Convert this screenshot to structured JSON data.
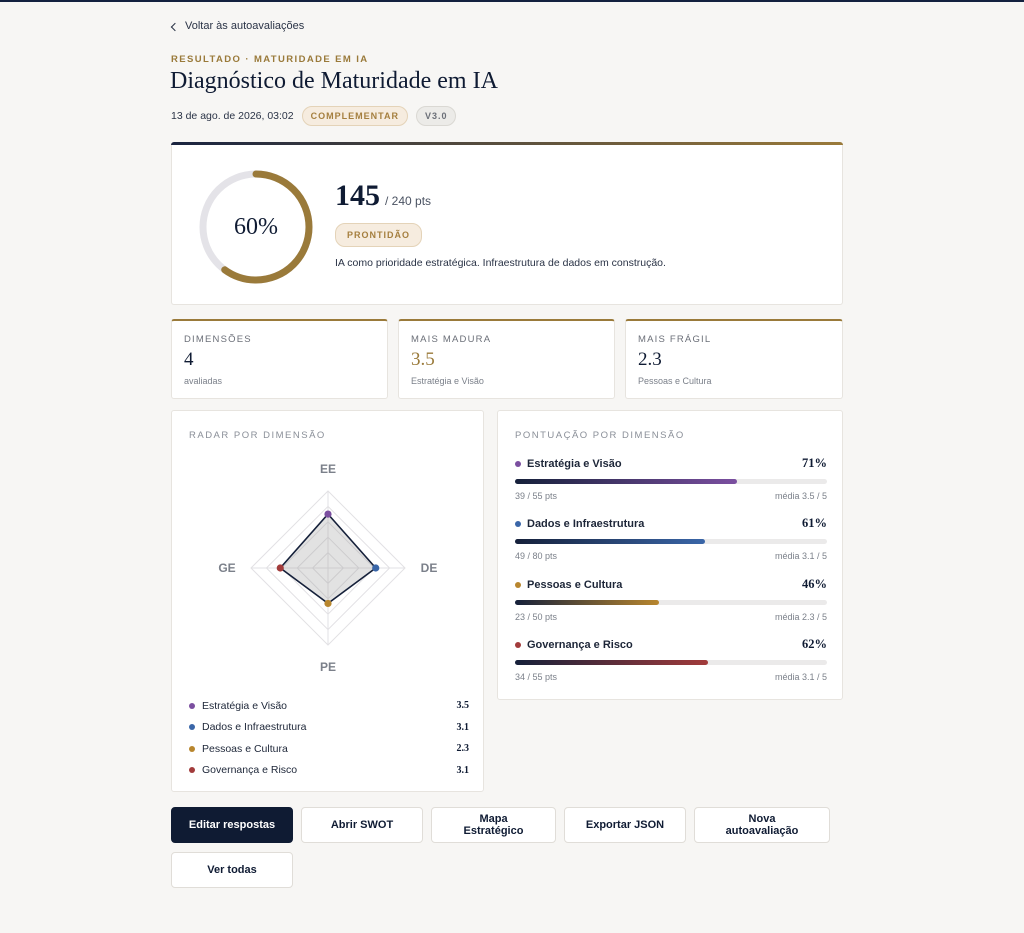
{
  "nav": {
    "back_label": "Voltar às autoavaliações"
  },
  "header": {
    "eyebrow": "RESULTADO · MATURIDADE EM IA",
    "title": "Diagnóstico de Maturidade em IA",
    "date": "13 de ago. de 2026, 03:02",
    "badge_type": "COMPLEMENTAR",
    "badge_version": "V3.0"
  },
  "summary": {
    "percent": 60,
    "percent_label": "60%",
    "score": "145",
    "max_label": "/ 240 pts",
    "level": "PRONTIDÃO",
    "description": "IA como prioridade estratégica. Infraestrutura de dados em construção."
  },
  "stats": [
    {
      "label": "DIMENSÕES",
      "value": "4",
      "sub": "avaliadas"
    },
    {
      "label": "MAIS MADURA",
      "value": "3.5",
      "sub": "Estratégia e Visão"
    },
    {
      "label": "MAIS FRÁGIL",
      "value": "2.3",
      "sub": "Pessoas e Cultura"
    }
  ],
  "radar": {
    "title": "RADAR POR DIMENSÃO",
    "max": 5,
    "axes": [
      {
        "code": "EE",
        "name": "Estratégia e Visão",
        "value": 3.5,
        "value_label": "3.5",
        "color": "#7b4fa0"
      },
      {
        "code": "DE",
        "name": "Dados e Infraestrutura",
        "value": 3.1,
        "value_label": "3.1",
        "color": "#3a66a8"
      },
      {
        "code": "PE",
        "name": "Pessoas e Cultura",
        "value": 2.3,
        "value_label": "2.3",
        "color": "#b8862e"
      },
      {
        "code": "GE",
        "name": "Governança e Risco",
        "value": 3.1,
        "value_label": "3.1",
        "color": "#a23b3b"
      }
    ]
  },
  "scores": {
    "title": "PONTUAÇÃO POR DIMENSÃO",
    "items": [
      {
        "name": "Estratégia e Visão",
        "percent": 71,
        "percent_label": "71%",
        "pts": "39 / 55 pts",
        "avg": "média 3.5 / 5",
        "color": "#7b4fa0"
      },
      {
        "name": "Dados e Infraestrutura",
        "percent": 61,
        "percent_label": "61%",
        "pts": "49 / 80 pts",
        "avg": "média 3.1 / 5",
        "color": "#3a66a8"
      },
      {
        "name": "Pessoas e Cultura",
        "percent": 46,
        "percent_label": "46%",
        "pts": "23 / 50 pts",
        "avg": "média 2.3 / 5",
        "color": "#b8862e"
      },
      {
        "name": "Governança e Risco",
        "percent": 62,
        "percent_label": "62%",
        "pts": "34 / 55 pts",
        "avg": "média 3.1 / 5",
        "color": "#a23b3b"
      }
    ]
  },
  "actions": {
    "edit": "Editar respostas",
    "swot": "Abrir SWOT",
    "map": "Mapa Estratégico",
    "export": "Exportar JSON",
    "new": "Nova autoavaliação",
    "all": "Ver todas"
  },
  "colors": {
    "navy": "#0f1b33",
    "gold": "#9a7a3a"
  }
}
